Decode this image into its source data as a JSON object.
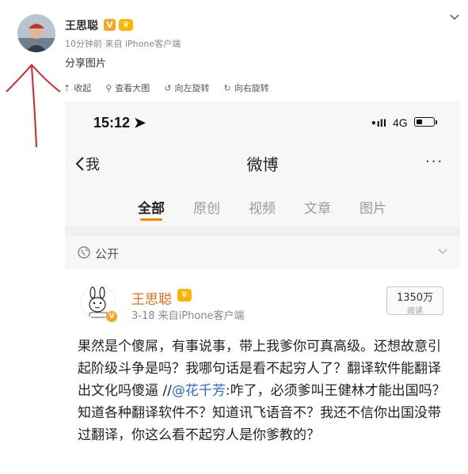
{
  "post": {
    "author": "王思聪",
    "badge_v": "V",
    "meta": "10分钟前 来自 iPhone客户端",
    "text": "分享图片",
    "toolbar": [
      {
        "icon": "collapse-icon",
        "glyph": "⇡",
        "label": "收起"
      },
      {
        "icon": "zoom-icon",
        "glyph": "⚲",
        "label": "查看大图"
      },
      {
        "icon": "rotate-left-icon",
        "glyph": "↺",
        "label": "向左旋转"
      },
      {
        "icon": "rotate-right-icon",
        "glyph": "↻",
        "label": "向右旋转"
      }
    ]
  },
  "phone": {
    "status": {
      "time": "15:12",
      "network": "4G"
    },
    "nav": {
      "back_label": "我",
      "title": "微博",
      "more": "···"
    },
    "tabs": [
      "全部",
      "原创",
      "视频",
      "文章",
      "图片"
    ],
    "privacy_label": "公开",
    "card": {
      "author": "王思聪",
      "meta": "3-18 来自iPhone客户端",
      "reads_count": "1350万",
      "reads_label": "阅读",
      "body_before": "果然是个傻屌，有事说事，带上我爹你可真高级。还想故意引起阶级斗争是吗？我哪句话是看不起穷人了？翻译软件能翻译出文化吗傻逼 //",
      "mention": "@花千芳",
      "body_after": ":咋了，必须爹叫王健林才能出国吗？知道各种翻译软件不？知道讯飞语音不？我还不信你出国没带过翻译，你这么看不起穷人是你爹教的？"
    }
  },
  "colors": {
    "accent_orange": "#ff8200",
    "name_orange": "#f26b22",
    "link_blue": "#2a6cc9",
    "annotation_red": "#d9232b"
  }
}
